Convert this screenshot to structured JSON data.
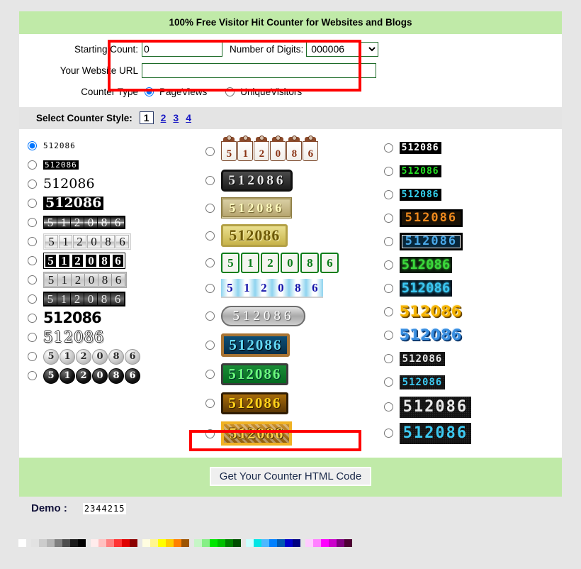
{
  "header": {
    "title": "100% Free Visitor Hit Counter for Websites and Blogs"
  },
  "form": {
    "starting_count_label": "Starting Count:",
    "starting_count_value": "0",
    "number_of_digits_label": "Number of Digits:",
    "number_of_digits_value": "000006",
    "number_of_digits_options": [
      "000006"
    ],
    "website_url_label": "Your Website URL",
    "website_url_value": "",
    "website_url_placeholder": "",
    "counter_type_label": "Counter Type",
    "counter_type_options": [
      "PageViews",
      "UniqueVisitors"
    ],
    "counter_type_selected": "PageViews"
  },
  "style_selector": {
    "label": "Select Counter Style:",
    "pages": [
      "1",
      "2",
      "3",
      "4"
    ],
    "current_page": "1"
  },
  "counter_sample_digits": "512086",
  "counters": {
    "column1": [
      {
        "name": "lcd-small-plain",
        "selected": true
      },
      {
        "name": "lcd-small-inverted",
        "selected": false
      },
      {
        "name": "serif-plain",
        "selected": false
      },
      {
        "name": "serif-bold-inverted",
        "selected": false
      },
      {
        "name": "odometer-dark",
        "selected": false
      },
      {
        "name": "odometer-light",
        "selected": false
      },
      {
        "name": "odometer-black-boxed",
        "selected": false
      },
      {
        "name": "odometer-gray",
        "selected": false
      },
      {
        "name": "odometer-dark-gloss",
        "selected": false
      },
      {
        "name": "bold-sans-large",
        "selected": false
      },
      {
        "name": "outline-serif",
        "selected": false
      },
      {
        "name": "balls-gray",
        "selected": false
      },
      {
        "name": "balls-black",
        "selected": false
      }
    ],
    "column2": [
      {
        "name": "flipcard-brown",
        "selected": false
      },
      {
        "name": "plate-black",
        "selected": false
      },
      {
        "name": "plate-tan",
        "selected": false
      },
      {
        "name": "plate-gold",
        "selected": false
      },
      {
        "name": "tiles-green",
        "selected": false
      },
      {
        "name": "tiles-blue-fan",
        "selected": false
      },
      {
        "name": "plate-oval-gray",
        "selected": false
      },
      {
        "name": "plate-blue",
        "selected": false
      },
      {
        "name": "plate-green",
        "selected": false
      },
      {
        "name": "plate-brown",
        "selected": false
      },
      {
        "name": "plate-gold-weave",
        "selected": false
      }
    ],
    "column3": [
      {
        "name": "seg-white",
        "selected": false
      },
      {
        "name": "seg-green",
        "selected": false
      },
      {
        "name": "seg-cyan",
        "selected": false
      },
      {
        "name": "seg-orange-boxed",
        "selected": false
      },
      {
        "name": "seg-blue-boxed",
        "selected": false
      },
      {
        "name": "seg-green-glow",
        "selected": false
      },
      {
        "name": "seg-cyan-glow",
        "selected": false
      },
      {
        "name": "3d-gold",
        "selected": false
      },
      {
        "name": "3d-blue",
        "selected": false
      },
      {
        "name": "dotmatrix-white-small",
        "selected": false
      },
      {
        "name": "dotmatrix-cyan-small",
        "selected": false
      },
      {
        "name": "dotmatrix-white-large",
        "selected": false
      },
      {
        "name": "dotmatrix-cyan-large",
        "selected": false
      }
    ]
  },
  "submit": {
    "label": "Get Your Counter HTML Code"
  },
  "demo": {
    "label": "Demo :",
    "value": "2344215"
  },
  "palette": {
    "groups": [
      [
        "#ffffff"
      ],
      [
        "#e2e2e2",
        "#cccccc",
        "#b4b4b4",
        "#808080",
        "#4d4d4d",
        "#1a1a1a",
        "#000000"
      ],
      [
        "#ffecec",
        "#ffc0c0",
        "#ff8080",
        "#ff3333",
        "#e00000",
        "#8b0000"
      ],
      [
        "#fffde0",
        "#fff68f",
        "#ffff00",
        "#ffcc00",
        "#ff8000",
        "#9c5402"
      ],
      [
        "#c6f5c6",
        "#86ef86",
        "#00e600",
        "#00c000",
        "#008000",
        "#004d00"
      ],
      [
        "#ccffff",
        "#00e5e5",
        "#4db8ff",
        "#0080ff",
        "#0059b3",
        "#0000cc",
        "#000080"
      ],
      [
        "#ffccff",
        "#ff80ff",
        "#ff00ff",
        "#cc00cc",
        "#800080",
        "#4d0033"
      ]
    ]
  },
  "colors": {
    "page_bg": "#e6e6e6",
    "card_bg": "#ffffff",
    "title_bg": "#c0eaa8",
    "strip_bg": "#e4e4e4",
    "input_border": "#1d6b28",
    "highlight": "#fe0000",
    "link": "#1a1ac4"
  }
}
